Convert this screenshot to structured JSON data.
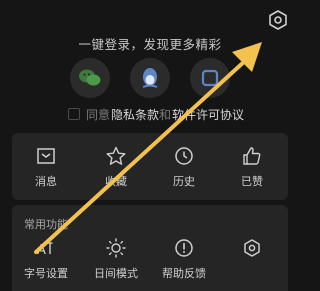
{
  "header": {
    "settings_icon": "hexagon-settings-icon"
  },
  "login": {
    "tip": "一键登录，发现更多精彩",
    "providers": [
      {
        "name": "wechat",
        "icon": "wechat-icon"
      },
      {
        "name": "qq",
        "icon": "qq-penguin-icon"
      },
      {
        "name": "other",
        "icon": "rounded-square-icon"
      }
    ],
    "agreement": {
      "prefix": "同意",
      "privacy": "隐私条款",
      "and": "和",
      "license": "软件许可协议"
    }
  },
  "quick": {
    "items": [
      {
        "label": "消息",
        "icon": "message-inbox-icon"
      },
      {
        "label": "收藏",
        "icon": "star-icon"
      },
      {
        "label": "历史",
        "icon": "clock-icon"
      },
      {
        "label": "已赞",
        "icon": "thumbs-up-icon"
      }
    ]
  },
  "common": {
    "title": "常用功能",
    "items": [
      {
        "label": "字号设置",
        "icon": "font-size-icon"
      },
      {
        "label": "日间模式",
        "icon": "sun-icon"
      },
      {
        "label": "帮助反馈",
        "icon": "help-alert-icon"
      },
      {
        "label": "",
        "icon": "hexagon-settings-icon"
      }
    ]
  },
  "colors": {
    "background": "#151515",
    "card": "#252525",
    "annotation_arrow": "#F2C14E"
  }
}
